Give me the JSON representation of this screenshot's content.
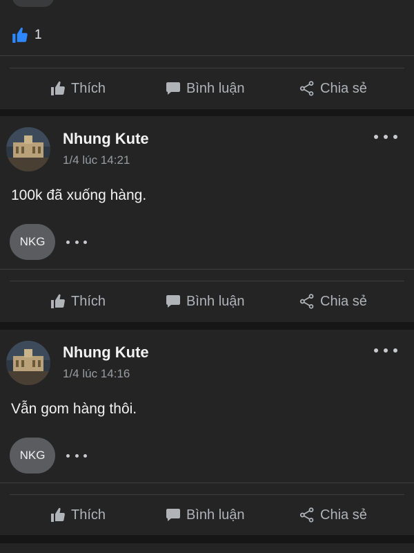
{
  "top": {
    "like_count": "1"
  },
  "actions": {
    "like": "Thích",
    "comment": "Bình luận",
    "share": "Chia sẻ"
  },
  "posts": [
    {
      "author": "Nhung Kute",
      "time": "1/4 lúc 14:21",
      "text": "100k đã xuống hàng.",
      "commenter": "NKG"
    },
    {
      "author": "Nhung Kute",
      "time": "1/4 lúc 14:16",
      "text": "Vẫn gom hàng thôi.",
      "commenter": "NKG"
    }
  ],
  "colors": {
    "background": "#161616",
    "card": "#242424",
    "like_blue": "#2d88ff",
    "muted": "#b0b3b8"
  },
  "icons": {
    "like": "thumbs-up-icon",
    "comment": "speech-bubble-icon",
    "share": "share-icon",
    "more": "more-dots-icon"
  }
}
